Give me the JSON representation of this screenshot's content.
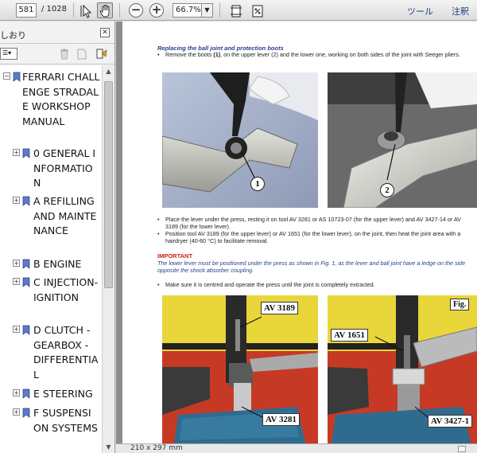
{
  "toolbar": {
    "current_page": "581",
    "total_pages": "/ 1028",
    "zoom": "66.7%",
    "tools_label": "ツール",
    "comment_label": "注釈"
  },
  "sidebar": {
    "title": "しおり",
    "tree": [
      {
        "label": "FERRARI CHALLENGE STRADALE WORKSHOP MANUAL"
      },
      {
        "label": "0 GENERAL INFORMATION"
      },
      {
        "label": "A REFILLING AND MAINTENANCE"
      },
      {
        "label": "B ENGINE"
      },
      {
        "label": "C INJECTION-IGNITION"
      },
      {
        "label": "D CLUTCH - GEARBOX - DIFFERENTIAL"
      },
      {
        "label": "E STEERING"
      },
      {
        "label": "F SUSPENSION SYSTEMS"
      }
    ]
  },
  "document": {
    "section_title": "Replacing the ball joint and protection boots",
    "bullet1_a": "Remove the boots ",
    "bullet1_b": "(1)",
    "bullet1_c": ", on the upper lever (2) and  the lower one, working on both sides of the joint with Seeger pliers.",
    "bullet2": "Place the lever under the press, resting it on tool AV 3281 or AS 10723-07 (for the upper lever) and AV 3427-14 or AV 3189 (for the lower lever).",
    "bullet3": "Position tool AV 3189 (for the upper lever) or AV 1651 (for the lower lever), on the joint, then heat the joint area with a hairdryer (40-60 °C) to facilitate removal.",
    "important_label": "IMPORTANT",
    "important_text": "The lower lever must be positioned under the press as shown in Fig. 1, as the lever and ball joint have a ledge on the side opposite the shock absorber coupling.",
    "bullet4": "Make sure it is centred and operate the press until the joint is completely extracted.",
    "callout_1": "1",
    "callout_2": "2",
    "label_av3189": "AV 3189",
    "label_av3281": "AV 3281",
    "label_av1651": "AV 1651",
    "label_av3427": "AV 3427-1",
    "fig_label": "Fig.",
    "page_size": "210 x 297 mm"
  },
  "colors": {
    "section_title": "#2a3d8f",
    "important": "#d01a10"
  }
}
